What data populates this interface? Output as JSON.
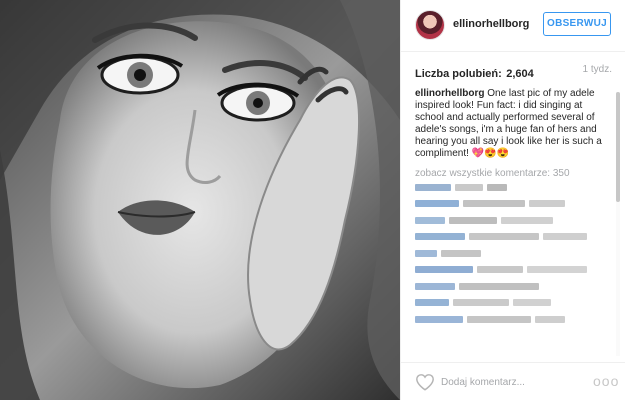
{
  "post": {
    "username": "ellinorhellborg",
    "follow_label": "OBSERWUJ",
    "likes_label": "Liczba polubień:",
    "likes_count": "2,604",
    "timestamp": "1 tydz.",
    "caption_author": "ellinorhellborg",
    "caption_text": "One last pic of my adele inspired look! Fun fact: i did singing at school and actually performed several of adele's songs, i'm a huge fan of hers and hearing you all say i look like her is such a compliment! 💖😍😍",
    "view_all_comments": "zobacz wszystkie komentarze: 350",
    "comment_placeholder": "Dodaj komentarz...",
    "more_icon_glyph": "ooo"
  },
  "icons": {
    "heart": "heart-icon",
    "more": "more-options-icon",
    "avatar": "avatar"
  },
  "colors": {
    "accent": "#3897f0",
    "muted_text": "#a5a7aa",
    "border": "#efefef"
  }
}
